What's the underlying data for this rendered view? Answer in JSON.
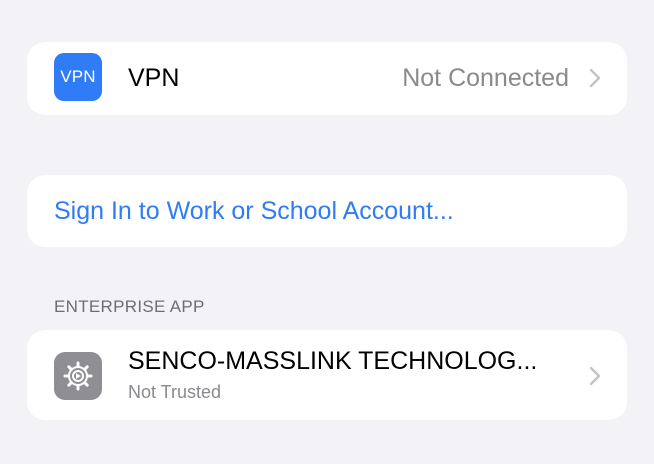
{
  "vpn": {
    "icon_label": "VPN",
    "title": "VPN",
    "status": "Not Connected"
  },
  "account": {
    "sign_in_label": "Sign In to Work or School Account..."
  },
  "enterprise": {
    "section_header": "ENTERPRISE APP",
    "app_name": "SENCO-MASSLINK TECHNOLOG...",
    "trust_status": "Not Trusted",
    "icon": "gear-icon"
  },
  "colors": {
    "background": "#f2f2f7",
    "accent": "#2f7cf6",
    "secondary_text": "#8a8a8e"
  }
}
